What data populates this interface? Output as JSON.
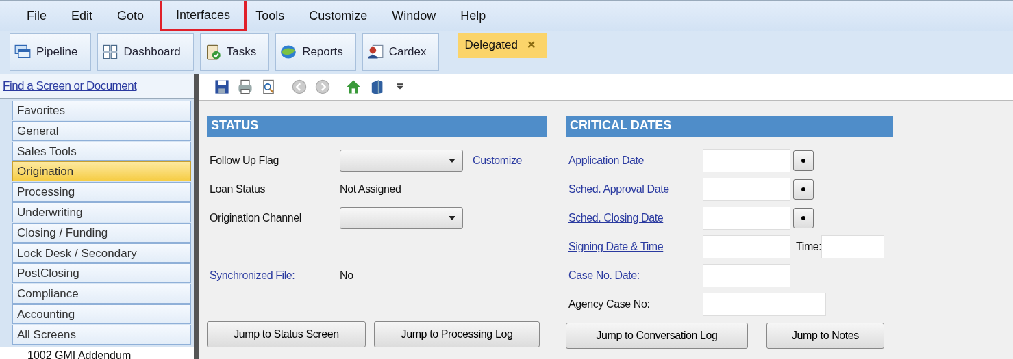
{
  "menu": [
    {
      "label": "File",
      "highlighted": false
    },
    {
      "label": "Edit",
      "highlighted": false
    },
    {
      "label": "Goto",
      "highlighted": false
    },
    {
      "label": "Interfaces",
      "highlighted": true
    },
    {
      "label": "Tools",
      "highlighted": false
    },
    {
      "label": "Customize",
      "highlighted": false
    },
    {
      "label": "Window",
      "highlighted": false
    },
    {
      "label": "Help",
      "highlighted": false
    }
  ],
  "toolbar": [
    {
      "label": "Pipeline"
    },
    {
      "label": "Dashboard"
    },
    {
      "label": "Tasks"
    },
    {
      "label": "Reports"
    },
    {
      "label": "Cardex"
    }
  ],
  "open_tab": {
    "label": "Delegated",
    "close": "×"
  },
  "sidebar": {
    "find_link": "Find a Screen or Document",
    "items": [
      {
        "label": "Favorites",
        "selected": false
      },
      {
        "label": "General",
        "selected": false
      },
      {
        "label": "Sales Tools",
        "selected": false
      },
      {
        "label": "Origination",
        "selected": true
      },
      {
        "label": "Processing",
        "selected": false
      },
      {
        "label": "Underwriting",
        "selected": false
      },
      {
        "label": "Closing / Funding",
        "selected": false
      },
      {
        "label": "Lock Desk / Secondary",
        "selected": false
      },
      {
        "label": "PostClosing",
        "selected": false
      },
      {
        "label": "Compliance",
        "selected": false
      },
      {
        "label": "Accounting",
        "selected": false
      },
      {
        "label": "All Screens",
        "selected": false
      }
    ],
    "screen_item": "1002 GMI Addendum"
  },
  "status": {
    "title": "STATUS",
    "rows": [
      {
        "kind": "dropdown",
        "label": "Follow Up Flag",
        "link": "Customize"
      },
      {
        "kind": "text",
        "label": "Loan Status",
        "value": "Not Assigned"
      },
      {
        "kind": "dropdown",
        "label": "Origination Channel"
      },
      {
        "kind": "link-text",
        "label": "Synchronized File:",
        "value": "No"
      }
    ],
    "buttons": [
      "Jump to Status Screen",
      "Jump to Processing Log"
    ]
  },
  "critical_dates": {
    "title": "CRITICAL DATES",
    "rows": [
      {
        "kind": "date",
        "label": "Application Date"
      },
      {
        "kind": "date",
        "label": "Sched. Approval Date"
      },
      {
        "kind": "date",
        "label": "Sched. Closing Date"
      },
      {
        "kind": "datetime",
        "label": "Signing Date & Time",
        "time_label": "Time:"
      },
      {
        "kind": "link-field",
        "label": "Case No. Date:"
      },
      {
        "kind": "plain-field",
        "label": "Agency Case No:"
      }
    ],
    "buttons": [
      "Jump to Conversation Log",
      "Jump to Notes"
    ]
  }
}
